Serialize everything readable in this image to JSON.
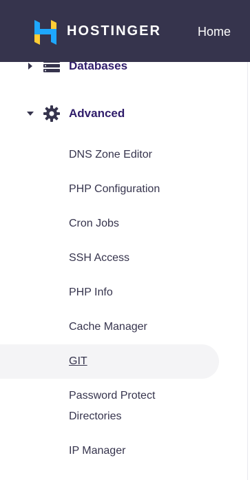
{
  "header": {
    "brand": "HOSTINGER",
    "nav_home": "Home",
    "colors": {
      "background": "#36344d",
      "logo_blue": "#1ea7fd",
      "logo_yellow": "#ffcd35"
    }
  },
  "sidebar": {
    "databases": {
      "label": "Databases",
      "icon": "database-icon",
      "expanded": false
    },
    "advanced": {
      "label": "Advanced",
      "icon": "gear-icon",
      "expanded": true,
      "items": [
        {
          "label": "DNS Zone Editor"
        },
        {
          "label": "PHP Configuration"
        },
        {
          "label": "Cron Jobs"
        },
        {
          "label": "SSH Access"
        },
        {
          "label": "PHP Info"
        },
        {
          "label": "Cache Manager"
        },
        {
          "label": "GIT",
          "active": true
        },
        {
          "label_line1": "Password Protect",
          "label_line2": "Directories"
        },
        {
          "label": "IP Manager"
        }
      ]
    },
    "colors": {
      "section_text": "#2f1c6a",
      "item_text": "#36344d",
      "active_bg": "#f4f4f6"
    }
  }
}
